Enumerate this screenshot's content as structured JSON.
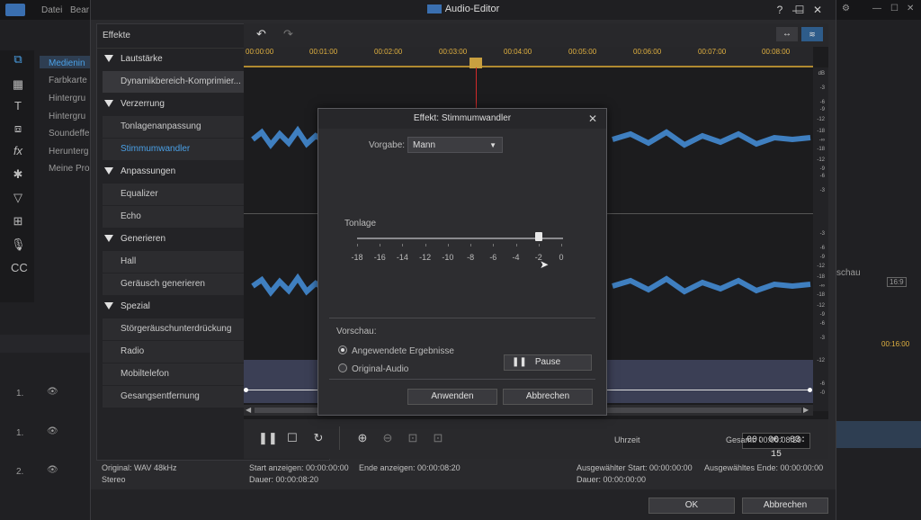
{
  "background": {
    "menu": [
      "Datei",
      "Bear"
    ],
    "left_list": [
      "Medienin",
      "Farbkarte",
      "Hintergru",
      "Hintergru",
      "Soundeffe",
      "Herunterg",
      "Meine Pro"
    ],
    "right_label": "schau",
    "right_time": "00:16:00",
    "track_labels": [
      "1.",
      "1.",
      "2."
    ],
    "resolution": "16:9"
  },
  "window": {
    "title": "Audio-Editor",
    "help": "?"
  },
  "effects": {
    "header": "Effekte",
    "categories": [
      {
        "label": "Lautstärke",
        "items": [
          "Dynamikbereich-Komprimier..."
        ]
      },
      {
        "label": "Verzerrung",
        "items": [
          "Tonlagenanpassung",
          "Stimmumwandler"
        ]
      },
      {
        "label": "Anpassungen",
        "items": [
          "Equalizer",
          "Echo"
        ]
      },
      {
        "label": "Generieren",
        "items": [
          "Hall",
          "Geräusch generieren"
        ]
      },
      {
        "label": "Spezial",
        "items": [
          "Störgeräuschunterdrückung",
          "Radio",
          "Mobiltelefon",
          "Gesangsentfernung"
        ]
      }
    ]
  },
  "timeline": {
    "ticks": [
      "00:00:00",
      "00:01:00",
      "00:02:00",
      "00:03:00",
      "00:04:00",
      "00:05:00",
      "00:06:00",
      "00:07:00",
      "00:08:00"
    ],
    "db_top": [
      "dB",
      "-3",
      "-6",
      "-9",
      "-12",
      "-18",
      "-∞",
      "-18",
      "-12",
      "-9",
      "-6",
      "-3"
    ],
    "db_bottom": [
      "-3",
      "-6",
      "-9",
      "-12",
      "-18",
      "-∞",
      "-18",
      "-12",
      "-9",
      "-6",
      "-3"
    ],
    "db_env": [
      "-12",
      "-6",
      "-0"
    ]
  },
  "controls": {
    "time_label": "Uhrzeit",
    "time_value": "00: 00: 03: 15",
    "total": "Gesamt: 00:00:08:20"
  },
  "status": {
    "original": "Original: WAV 48kHz",
    "channels": "Stereo",
    "start_show": "Start anzeigen: 00:00:00:00",
    "end_show": "Ende anzeigen: 00:00:08:20",
    "duration": "Dauer: 00:00:08:20",
    "sel_start": "Ausgewählter Start: 00:00:00:00",
    "sel_end": "Ausgewähltes Ende: 00:00:00:00",
    "sel_duration": "Dauer: 00:00:00:00"
  },
  "footer": {
    "ok": "OK",
    "cancel": "Abbrechen"
  },
  "dialog": {
    "title": "Effekt: Stimmumwandler",
    "preset_label": "Vorgabe:",
    "preset_value": "Mann",
    "pitch_label": "Tonlage",
    "scale": [
      "-18",
      "-16",
      "-14",
      "-12",
      "-10",
      "-8",
      "-6",
      "-4",
      "-2",
      "0"
    ],
    "pitch_value": -2,
    "preview_label": "Vorschau:",
    "radio_applied": "Angewendete Ergebnisse",
    "radio_original": "Original-Audio",
    "pause": "Pause",
    "apply": "Anwenden",
    "cancel": "Abbrechen"
  },
  "colors": {
    "accent": "#4aa0e6",
    "wave": "#3f7fc0",
    "ruler": "#e0b040"
  }
}
